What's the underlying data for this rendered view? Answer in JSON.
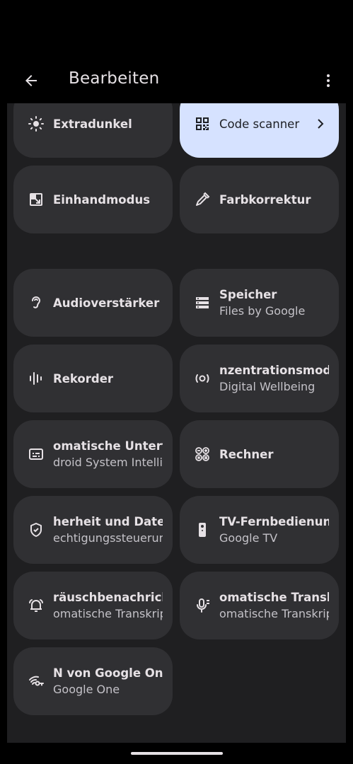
{
  "header": {
    "title": "Bearbeiten"
  },
  "tiles": [
    {
      "label": "Extradunkel",
      "icon": "brightness-icon"
    },
    {
      "label": "Code scanner",
      "icon": "qr-code-icon",
      "active": true
    },
    {
      "label": "Einhandmodus",
      "icon": "one-handed-icon"
    },
    {
      "label": "Farbkorrektur",
      "icon": "color-picker-icon"
    },
    {
      "label": "Audioverstärker",
      "icon": "hearing-icon"
    },
    {
      "label": "Speicher",
      "sub": "Files by Google",
      "icon": "storage-icon"
    },
    {
      "label": "Rekorder",
      "icon": "waveform-icon"
    },
    {
      "label": "nzentrationsmodus",
      "sub": "Digital Wellbeing",
      "icon": "focus-mode-icon"
    },
    {
      "label": "omatische Untertit",
      "sub": "droid System Intellig",
      "icon": "captions-icon"
    },
    {
      "label": "Rechner",
      "icon": "calculator-icon"
    },
    {
      "label": "herheit und Datens",
      "sub": "echtigungssteuerun",
      "icon": "security-shield-icon"
    },
    {
      "label": "TV-Fernbedienung",
      "sub": "Google TV",
      "icon": "tv-remote-icon"
    },
    {
      "label": "räuschbenachricht",
      "sub": "omatische Transkrip",
      "icon": "sound-notification-icon"
    },
    {
      "label": "omatische Transkr",
      "sub": "omatische Transkrip",
      "icon": "transcribe-icon"
    },
    {
      "label": "N von Google One",
      "sub": "Google One",
      "icon": "vpn-key-icon"
    }
  ],
  "colors": {
    "background": "#000000",
    "panel": "#1f1f21",
    "tile": "#303033",
    "active_tile": "#d6e2ff"
  }
}
